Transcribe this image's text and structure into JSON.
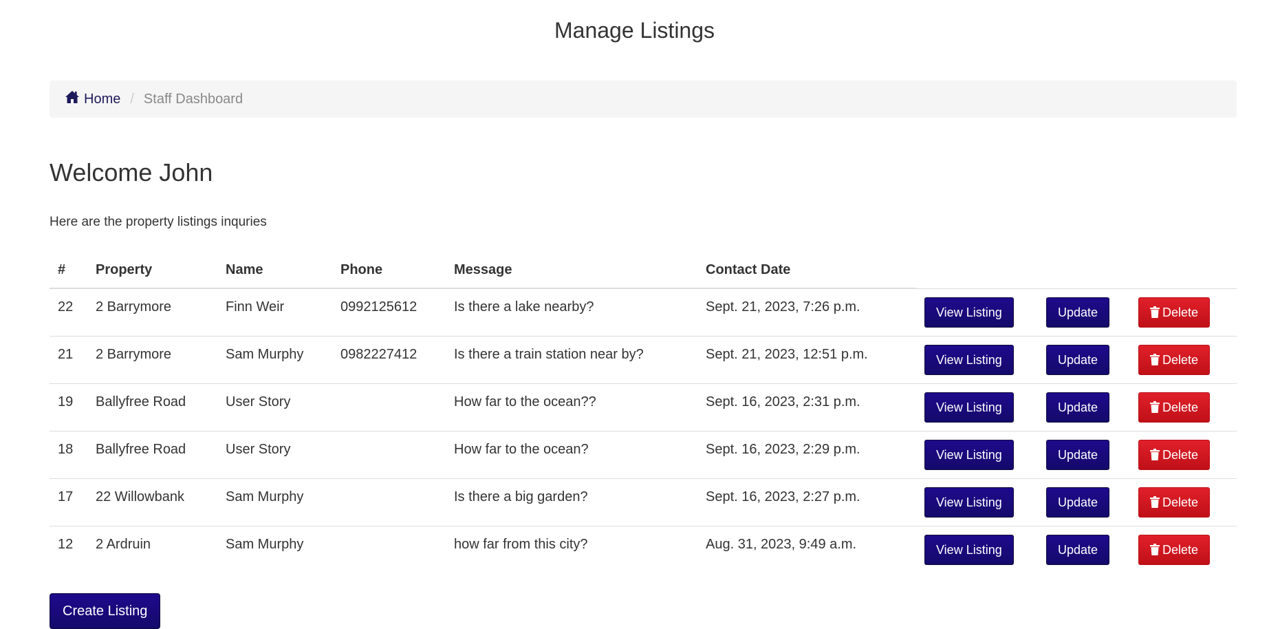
{
  "page": {
    "title": "Manage Listings"
  },
  "breadcrumb": {
    "home": "Home",
    "current": "Staff Dashboard"
  },
  "welcome": "Welcome John",
  "intro": "Here are the property listings inquries",
  "table": {
    "headers": [
      "#",
      "Property",
      "Name",
      "Phone",
      "Message",
      "Contact Date"
    ],
    "rows": [
      {
        "id": "22",
        "property": "2 Barrymore",
        "name": "Finn Weir",
        "phone": "0992125612",
        "message": "Is there a lake nearby?",
        "date": "Sept. 21, 2023, 7:26 p.m."
      },
      {
        "id": "21",
        "property": "2 Barrymore",
        "name": "Sam Murphy",
        "phone": "0982227412",
        "message": "Is there a train station near by?",
        "date": "Sept. 21, 2023, 12:51 p.m."
      },
      {
        "id": "19",
        "property": "Ballyfree Road",
        "name": "User Story",
        "phone": "",
        "message": "How far to the ocean??",
        "date": "Sept. 16, 2023, 2:31 p.m."
      },
      {
        "id": "18",
        "property": "Ballyfree Road",
        "name": "User Story",
        "phone": "",
        "message": "How far to the ocean?",
        "date": "Sept. 16, 2023, 2:29 p.m."
      },
      {
        "id": "17",
        "property": "22 Willowbank",
        "name": "Sam Murphy",
        "phone": "",
        "message": "Is there a big garden?",
        "date": "Sept. 16, 2023, 2:27 p.m."
      },
      {
        "id": "12",
        "property": "2 Ardruin",
        "name": "Sam Murphy",
        "phone": "",
        "message": "how far from this city?",
        "date": "Aug. 31, 2023, 9:49 a.m."
      }
    ],
    "actions": {
      "view": "View Listing",
      "update": "Update",
      "delete": "Delete"
    }
  },
  "create_button": "Create Listing",
  "colors": {
    "primary": "#1a0a7a",
    "danger": "#d41a22",
    "breadcrumb_bg": "#f5f5f5"
  },
  "icons": {
    "home": "home-icon",
    "delete": "trash-icon"
  }
}
